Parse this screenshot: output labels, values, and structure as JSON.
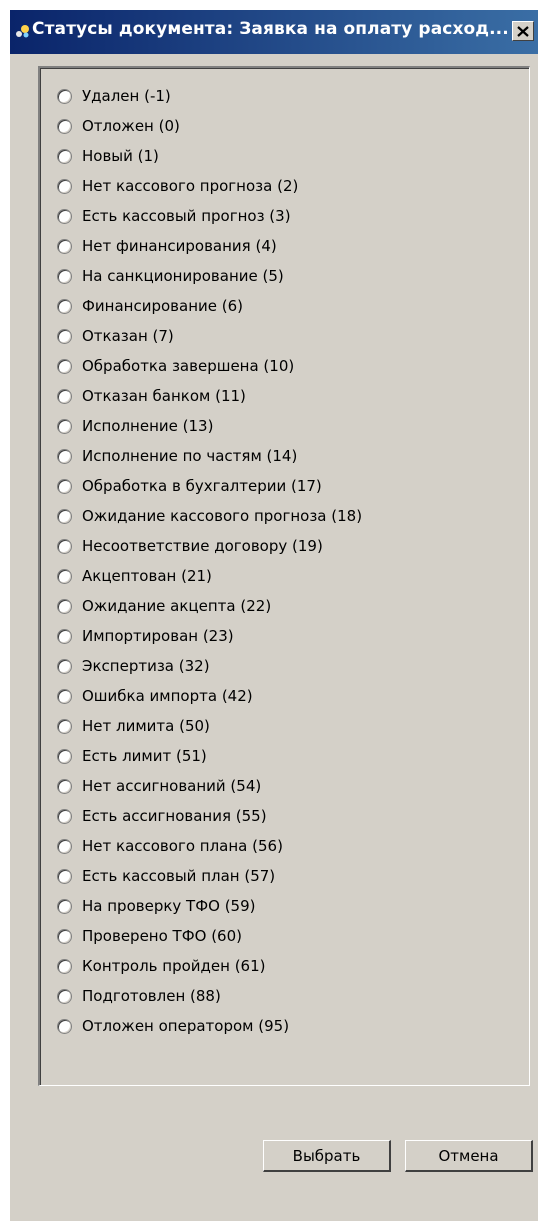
{
  "window": {
    "title": "Статусы документа: Заявка на оплату расход...",
    "close_icon": "close-icon"
  },
  "statuses": [
    {
      "label": "Удален (-1)"
    },
    {
      "label": "Отложен (0)"
    },
    {
      "label": "Новый (1)"
    },
    {
      "label": "Нет кассового прогноза (2)"
    },
    {
      "label": "Есть кассовый прогноз (3)"
    },
    {
      "label": "Нет финансирования (4)"
    },
    {
      "label": "На санкционирование (5)"
    },
    {
      "label": "Финансирование (6)"
    },
    {
      "label": "Отказан (7)"
    },
    {
      "label": "Обработка завершена (10)"
    },
    {
      "label": "Отказан банком (11)"
    },
    {
      "label": "Исполнение (13)"
    },
    {
      "label": "Исполнение по частям (14)"
    },
    {
      "label": "Обработка в бухгалтерии (17)"
    },
    {
      "label": "Ожидание кассового прогноза (18)"
    },
    {
      "label": "Несоответствие договору (19)"
    },
    {
      "label": "Акцептован (21)"
    },
    {
      "label": "Ожидание акцепта (22)"
    },
    {
      "label": "Импортирован (23)"
    },
    {
      "label": "Экспертиза (32)"
    },
    {
      "label": "Ошибка импорта (42)"
    },
    {
      "label": "Нет лимита (50)"
    },
    {
      "label": "Есть лимит (51)"
    },
    {
      "label": "Нет ассигнований (54)"
    },
    {
      "label": "Есть ассигнования (55)"
    },
    {
      "label": "Нет кассового плана (56)"
    },
    {
      "label": "Есть кассовый план (57)"
    },
    {
      "label": "На проверку ТФО (59)"
    },
    {
      "label": "Проверено ТФО (60)"
    },
    {
      "label": "Контроль пройден (61)"
    },
    {
      "label": "Подготовлен (88)"
    },
    {
      "label": "Отложен оператором (95)"
    }
  ],
  "buttons": {
    "select_label": "Выбрать",
    "cancel_label": "Отмена"
  },
  "colors": {
    "titlebar_start": "#0a246a",
    "titlebar_end": "#3a6ea5",
    "face": "#d4d0c8"
  }
}
